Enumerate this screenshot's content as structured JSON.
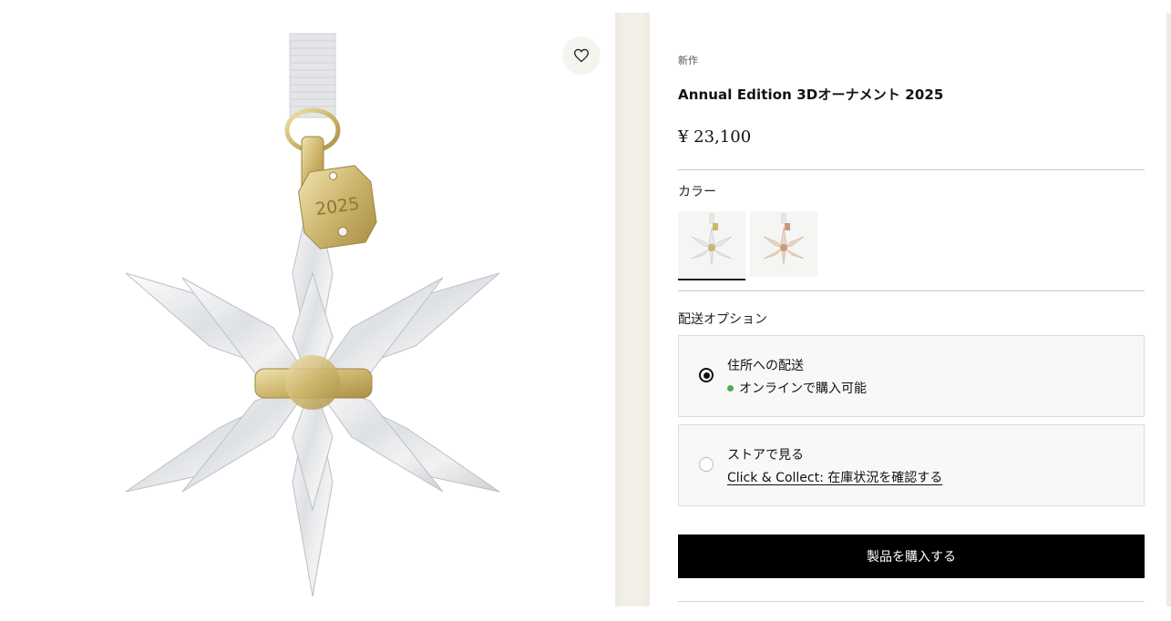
{
  "product": {
    "badge": "新作",
    "title": "Annual Edition 3Dオーナメント 2025",
    "price": "¥ 23,100",
    "image_engraving": "2025"
  },
  "colors": {
    "label": "カラー",
    "swatches": [
      {
        "name": "gold-tone",
        "selected": true
      },
      {
        "name": "rose-gold-tone",
        "selected": false
      }
    ]
  },
  "shipping": {
    "label": "配送オプション",
    "options": [
      {
        "title": "住所への配送",
        "subtitle": "オンラインで購入可能",
        "selected": true,
        "status_color": "#4cae5a"
      },
      {
        "title": "ストアで見る",
        "subtitle": "Click & Collect: 在庫状況を確認する",
        "selected": false
      }
    ]
  },
  "actions": {
    "buy_label": "製品を購入する",
    "wishlist_icon": "heart-icon"
  },
  "theme": {
    "accent": "#000000",
    "panel_bg": "#eeebe1",
    "available": "#4cae5a"
  }
}
